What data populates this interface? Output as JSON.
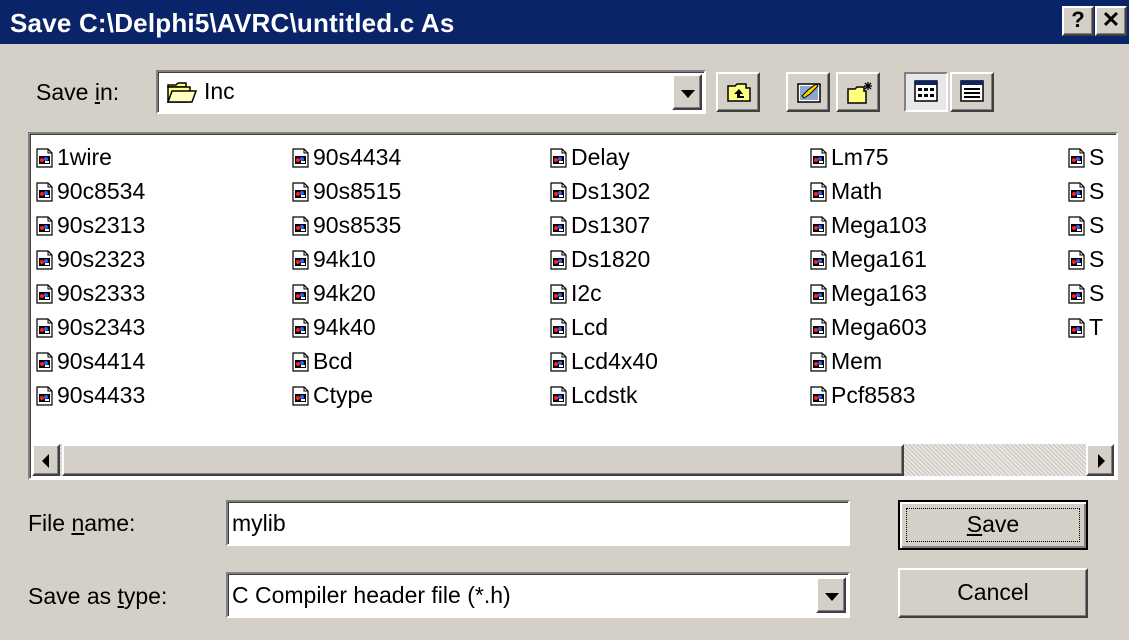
{
  "window": {
    "title": "Save C:\\Delphi5\\AVRC\\untitled.c As",
    "help_glyph": "?",
    "close_glyph": "✕"
  },
  "save_in": {
    "label_pre": "Save ",
    "label_accel": "i",
    "label_post": "n:",
    "value": "Inc",
    "icon": "folder-open-icon"
  },
  "toolbar": {
    "up_folder": "up-one-level-icon",
    "desktop": "desktop-icon",
    "new_folder": "create-new-folder-icon",
    "list_view": "list-view-icon",
    "details_view": "details-view-icon"
  },
  "files": [
    [
      "1wire",
      "90c8534",
      "90s2313",
      "90s2323",
      "90s2333",
      "90s2343",
      "90s4414",
      "90s4433"
    ],
    [
      "90s4434",
      "90s8515",
      "90s8535",
      "94k10",
      "94k20",
      "94k40",
      "Bcd",
      "Ctype"
    ],
    [
      "Delay",
      "Ds1302",
      "Ds1307",
      "Ds1820",
      "I2c",
      "Lcd",
      "Lcd4x40",
      "Lcdstk"
    ],
    [
      "Lm75",
      "Math",
      "Mega103",
      "Mega161",
      "Mega163",
      "Mega603",
      "Mem",
      "Pcf8583"
    ],
    [
      "S",
      "S",
      "S",
      "S",
      "S",
      "T"
    ]
  ],
  "file_name": {
    "label_pre": "File ",
    "label_accel": "n",
    "label_post": "ame:",
    "value": "mylib"
  },
  "save_as_type": {
    "label_pre": "Save as ",
    "label_accel": "t",
    "label_post": "ype:",
    "value": "C Compiler header file (*.h)"
  },
  "buttons": {
    "save_accel": "S",
    "save_rest": "ave",
    "cancel": "Cancel"
  },
  "colors": {
    "titlebar": "#0a246a",
    "face": "#d4d0c8"
  }
}
